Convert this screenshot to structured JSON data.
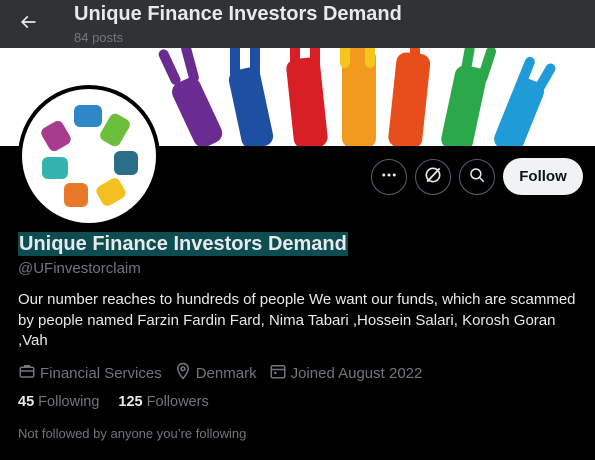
{
  "header": {
    "title": "Unique Finance Investors Demand",
    "subtitle": "84 posts",
    "back_icon": "arrow-left-icon"
  },
  "profile": {
    "display_name": "Unique Finance Investors Demand",
    "handle": "@UFinvestorclaim",
    "bio": "Our number reaches to hundreds of people We want our funds, which are scammed by people named Farzin Fardin Fard, Nima Tabari ,Hossein Salari, Korosh Goran ,Vah",
    "category": "Financial Services",
    "location": "Denmark",
    "joined": "Joined August 2022",
    "following_count": "45",
    "following_label": "Following",
    "followers_count": "125",
    "followers_label": "Followers",
    "followed_by_note": "Not followed by anyone you’re following"
  },
  "actions": {
    "more_icon": "more-dots-icon",
    "grok_icon": "grok-icon",
    "search_icon": "search-icon",
    "follow_label": "Follow"
  },
  "colors": {
    "background": "#000000",
    "header_bg": "#2f3336",
    "text_primary": "#e7e9ea",
    "text_secondary": "#71767b",
    "follow_bg": "#eff3f4",
    "name_highlight": "#0d4d52"
  }
}
